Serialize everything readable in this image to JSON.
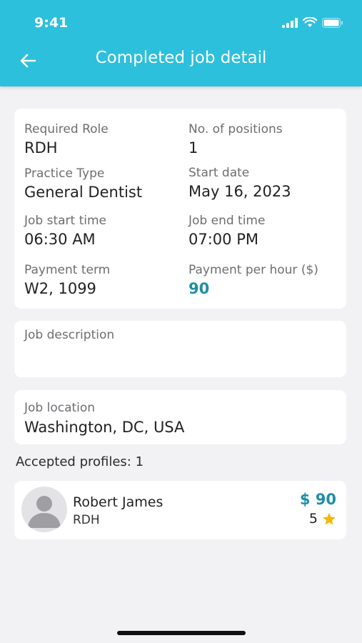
{
  "status_bar": {
    "time": "9:41"
  },
  "header": {
    "title": "Completed job detail"
  },
  "details": {
    "required_role_label": "Required Role",
    "required_role": "RDH",
    "positions_label": "No. of positions",
    "positions": "1",
    "practice_type_label": "Practice Type",
    "practice_type": "General Dentist",
    "start_date_label": "Start date",
    "start_date": "May 16, 2023",
    "job_start_label": "Job start time",
    "job_start": "06:30 AM",
    "job_end_label": "Job end time",
    "job_end": "07:00 PM",
    "payment_term_label": "Payment term",
    "payment_term": "W2, 1099",
    "payment_hour_label": "Payment per hour ($)",
    "payment_hour": "90"
  },
  "description": {
    "label": "Job description"
  },
  "location": {
    "label": "Job location",
    "value": "Washington, DC, USA"
  },
  "accepted": {
    "title": "Accepted profiles: 1"
  },
  "profile": {
    "name": "Robert James",
    "role": "RDH",
    "price": "$ 90",
    "rating": "5"
  },
  "colors": {
    "header": "#2cc0dc",
    "accent": "#1e8fa6",
    "star": "#f5b800"
  },
  "icons": {
    "back": "arrow-left-icon",
    "star": "star-icon",
    "avatar": "person-placeholder-icon"
  }
}
